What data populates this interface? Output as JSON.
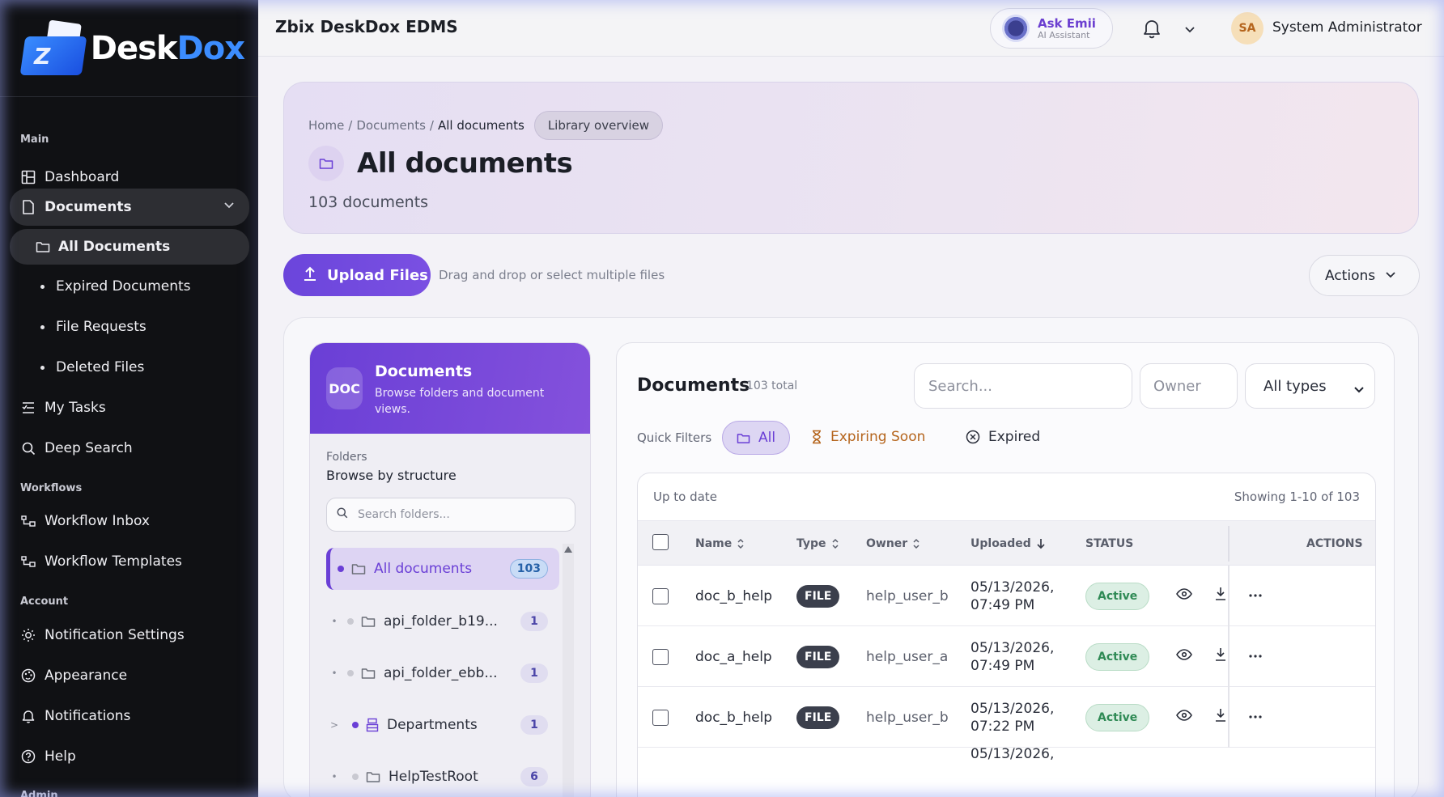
{
  "brand": {
    "desk": "Desk",
    "dox": "Dox",
    "mark": "Z"
  },
  "sidebar": {
    "sections": {
      "main": "Main",
      "workflows": "Workflows",
      "account": "Account",
      "admin": "Admin"
    },
    "items": {
      "dashboard": "Dashboard",
      "documents": "Documents",
      "all_documents": "All Documents",
      "expired_documents": "Expired Documents",
      "file_requests": "File Requests",
      "deleted_files": "Deleted Files",
      "my_tasks": "My Tasks",
      "deep_search": "Deep Search",
      "workflow_inbox": "Workflow Inbox",
      "workflow_templates": "Workflow Templates",
      "notification_settings": "Notification Settings",
      "appearance": "Appearance",
      "notifications": "Notifications",
      "help": "Help"
    }
  },
  "header": {
    "title": "Zbix DeskDox EDMS",
    "assistant": {
      "title": "Ask Emii",
      "subtitle": "AI Assistant"
    },
    "user": {
      "initials": "SA",
      "name": "System Administrator"
    }
  },
  "hero": {
    "breadcrumb": {
      "home": "Home",
      "sep": "/",
      "documents": "Documents",
      "current": "All documents"
    },
    "pill": "Library overview",
    "title": "All documents",
    "count": "103 documents"
  },
  "toolbar": {
    "upload": "Upload Files",
    "hint": "Drag and drop or select multiple files",
    "actions": "Actions"
  },
  "folders": {
    "badge": "DOC",
    "title": "Documents",
    "description": "Browse folders and document views.",
    "label": "Folders",
    "sublabel": "Browse by structure",
    "search_placeholder": "Search folders...",
    "rows": [
      {
        "name": "All documents",
        "count": "103",
        "caret": ""
      },
      {
        "name": "api_folder_b19...",
        "count": "1",
        "caret": "•"
      },
      {
        "name": "api_folder_ebb...",
        "count": "1",
        "caret": "•"
      },
      {
        "name": "Departments",
        "count": "1",
        "caret": ">"
      },
      {
        "name": "HelpTestRoot",
        "count": "6",
        "caret": "•"
      }
    ]
  },
  "docs": {
    "title": "Documents",
    "total": "103 total",
    "search_placeholder": "Search...",
    "owner_placeholder": "Owner",
    "type_filter": "All types",
    "quick_filters": {
      "label": "Quick Filters",
      "all": "All",
      "expiring": "Expiring Soon",
      "expired": "Expired"
    },
    "table": {
      "status_text": "Up to date",
      "showing": "Showing 1-10 of 103",
      "columns": {
        "name": "Name",
        "type": "Type",
        "owner": "Owner",
        "uploaded": "Uploaded",
        "status": "STATUS",
        "actions": "ACTIONS"
      },
      "rows": [
        {
          "name": "doc_b_help",
          "type": "FILE",
          "owner": "help_user_b",
          "date": "05/13/2026,",
          "time": "07:49 PM",
          "status": "Active"
        },
        {
          "name": "doc_a_help",
          "type": "FILE",
          "owner": "help_user_a",
          "date": "05/13/2026,",
          "time": "07:49 PM",
          "status": "Active"
        },
        {
          "name": "doc_b_help",
          "type": "FILE",
          "owner": "help_user_b",
          "date": "05/13/2026,",
          "time": "07:22 PM",
          "status": "Active"
        }
      ],
      "partial_row_date": "05/13/2026,"
    }
  },
  "colors": {
    "accent": "#6a3fd6",
    "sidebar_bg": "#101114",
    "active_status": "#2f8a55",
    "expiring": "#b5651d"
  }
}
